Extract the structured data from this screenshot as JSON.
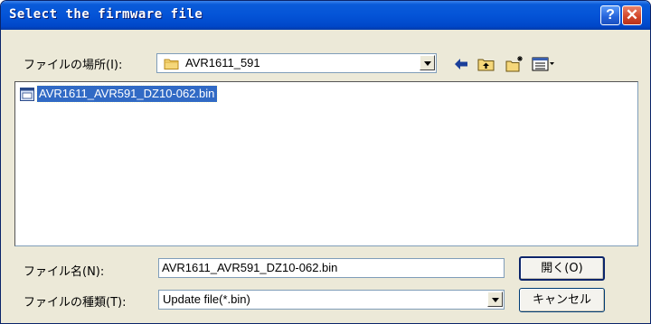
{
  "window": {
    "title": "Select the firmware file"
  },
  "titlebar": {
    "help_glyph": "?",
    "close_glyph": "✕"
  },
  "look_in": {
    "label": "ファイルの場所(I):",
    "value": "AVR1611_591",
    "icon": "folder-icon"
  },
  "toolbar": {
    "icons": [
      "back-arrow-icon",
      "up-folder-icon",
      "new-folder-icon",
      "view-menu-icon"
    ]
  },
  "files": [
    {
      "name": "AVR1611_AVR591_DZ10-062.bin",
      "icon": "bin-file-icon",
      "selected": true
    }
  ],
  "filename": {
    "label": "ファイル名(N):",
    "value": "AVR1611_AVR591_DZ10-062.bin"
  },
  "filetype": {
    "label": "ファイルの種類(T):",
    "value": "Update file(*.bin)"
  },
  "buttons": {
    "open": "開く(O)",
    "cancel": "キャンセル"
  },
  "colors": {
    "titlebar": "#0454d7",
    "dialog_bg": "#ece9d8",
    "selection": "#316ac5"
  }
}
